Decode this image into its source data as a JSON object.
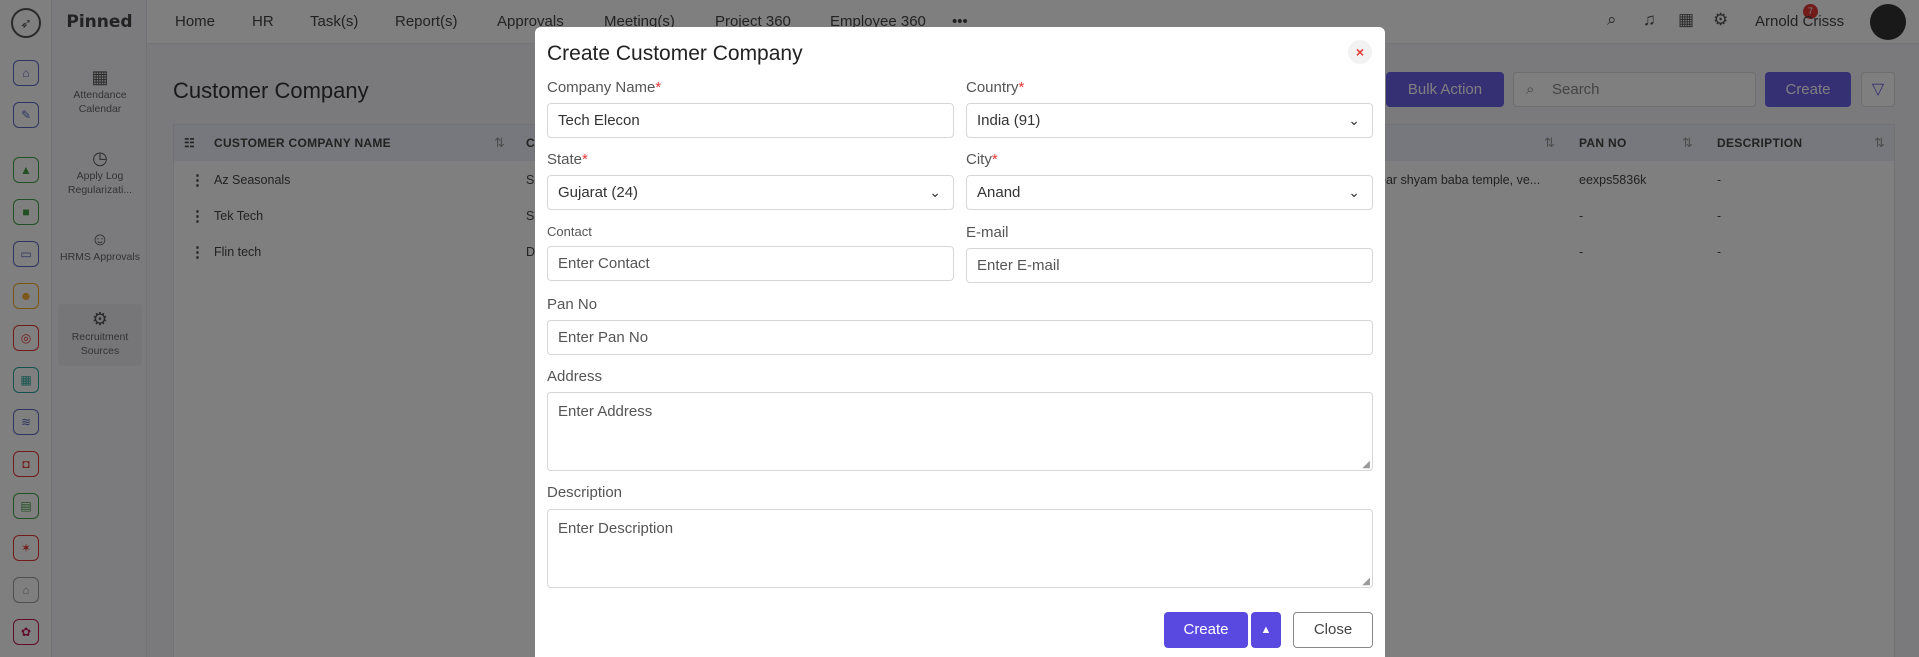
{
  "pinned": {
    "title": "Pinned",
    "items": [
      {
        "label": "Attendance Calendar",
        "icon": "calendar-icon"
      },
      {
        "label": "Apply Log Regularizati...",
        "icon": "clock-check-icon"
      },
      {
        "label": "HRMS Approvals",
        "icon": "user-check-icon"
      },
      {
        "label": "Recruitment Sources",
        "icon": "gear-icon"
      }
    ]
  },
  "nav": {
    "items": [
      "Home",
      "HR",
      "Task(s)",
      "Report(s)",
      "Approvals",
      "Meeting(s)",
      "Project 360",
      "Employee 360"
    ],
    "more": "•••",
    "notification_count": "7",
    "user_name": "Arnold Crisss"
  },
  "page": {
    "title": "Customer Company",
    "bulk_action": "Bulk Action",
    "search_placeholder": "Search",
    "create_label": "Create"
  },
  "table": {
    "columns": [
      "CUSTOMER COMPANY NAME",
      "C",
      "PAN NO",
      "DESCRIPTION"
    ],
    "rows": [
      {
        "name": "Az Seasonals",
        "c": "S",
        "address": "ear shyam baba temple, ve...",
        "pan": "eexps5836k",
        "description": "-"
      },
      {
        "name": "Tek Tech",
        "c": "S",
        "address": "",
        "pan": "-",
        "description": "-"
      },
      {
        "name": "Flin tech",
        "c": "D",
        "address": "",
        "pan": "-",
        "description": "-"
      }
    ]
  },
  "modal": {
    "title": "Create Customer Company",
    "company_name_label": "Company Name",
    "company_name_value": "Tech Elecon",
    "country_label": "Country",
    "country_value": "India (91)",
    "state_label": "State",
    "state_value": "Gujarat (24)",
    "city_label": "City",
    "city_value": "Anand",
    "contact_label": "Contact",
    "contact_placeholder": "Enter Contact",
    "email_label": "E-mail",
    "email_placeholder": "Enter E-mail",
    "pan_label": "Pan No",
    "pan_placeholder": "Enter Pan No",
    "address_label": "Address",
    "address_placeholder": "Enter Address",
    "description_label": "Description",
    "description_placeholder": "Enter Description",
    "required_mark": "*",
    "create_label": "Create",
    "close_label": "Close"
  },
  "colors": {
    "accent": "#5a49e0",
    "required": "#e53935"
  }
}
